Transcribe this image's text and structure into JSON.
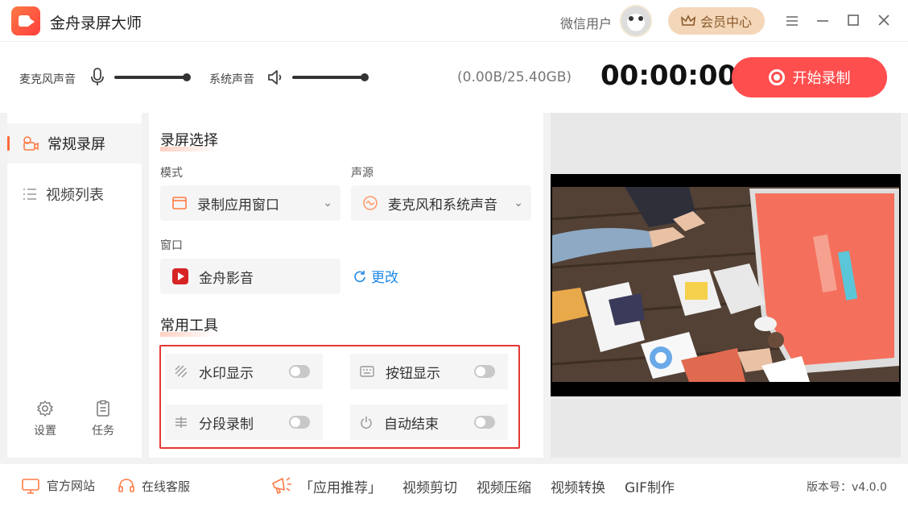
{
  "app": {
    "title": "金舟录屏大师"
  },
  "header": {
    "user_name": "微信用户",
    "vip_label": "会员中心"
  },
  "audio": {
    "mic_label": "麦克风声音",
    "mic_level": 1.0,
    "system_label": "系统声音",
    "system_level": 1.0,
    "storage": "(0.00B/25.40GB)",
    "timer": "00:00:00",
    "record_label": "开始录制"
  },
  "sidebar": {
    "items": [
      {
        "label": "常规录屏",
        "icon": "camera-icon",
        "active": true
      },
      {
        "label": "视频列表",
        "icon": "list-icon",
        "active": false
      }
    ],
    "settings_label": "设置",
    "tasks_label": "任务"
  },
  "panel": {
    "record_select_title": "录屏选择",
    "mode_label": "模式",
    "mode_value": "录制应用窗口",
    "audio_source_label": "声源",
    "audio_source_value": "麦克风和系统声音",
    "window_label": "窗口",
    "window_value": "金舟影音",
    "change_label": "更改",
    "tools_title": "常用工具",
    "tools": [
      {
        "label": "水印显示",
        "icon": "watermark-icon",
        "on": false
      },
      {
        "label": "按钮显示",
        "icon": "keyboard-icon",
        "on": false
      },
      {
        "label": "分段录制",
        "icon": "segment-icon",
        "on": false
      },
      {
        "label": "自动结束",
        "icon": "power-icon",
        "on": false
      }
    ]
  },
  "footer": {
    "official_site": "官方网站",
    "online_service": "在线客服",
    "links": [
      "「应用推荐」",
      "视频剪切",
      "视频压缩",
      "视频转换",
      "GIF制作"
    ],
    "version": "版本号：v4.0.0"
  },
  "colors": {
    "accent": "#ff4e4e",
    "highlight_border": "#e53935",
    "link": "#1e88e5"
  }
}
